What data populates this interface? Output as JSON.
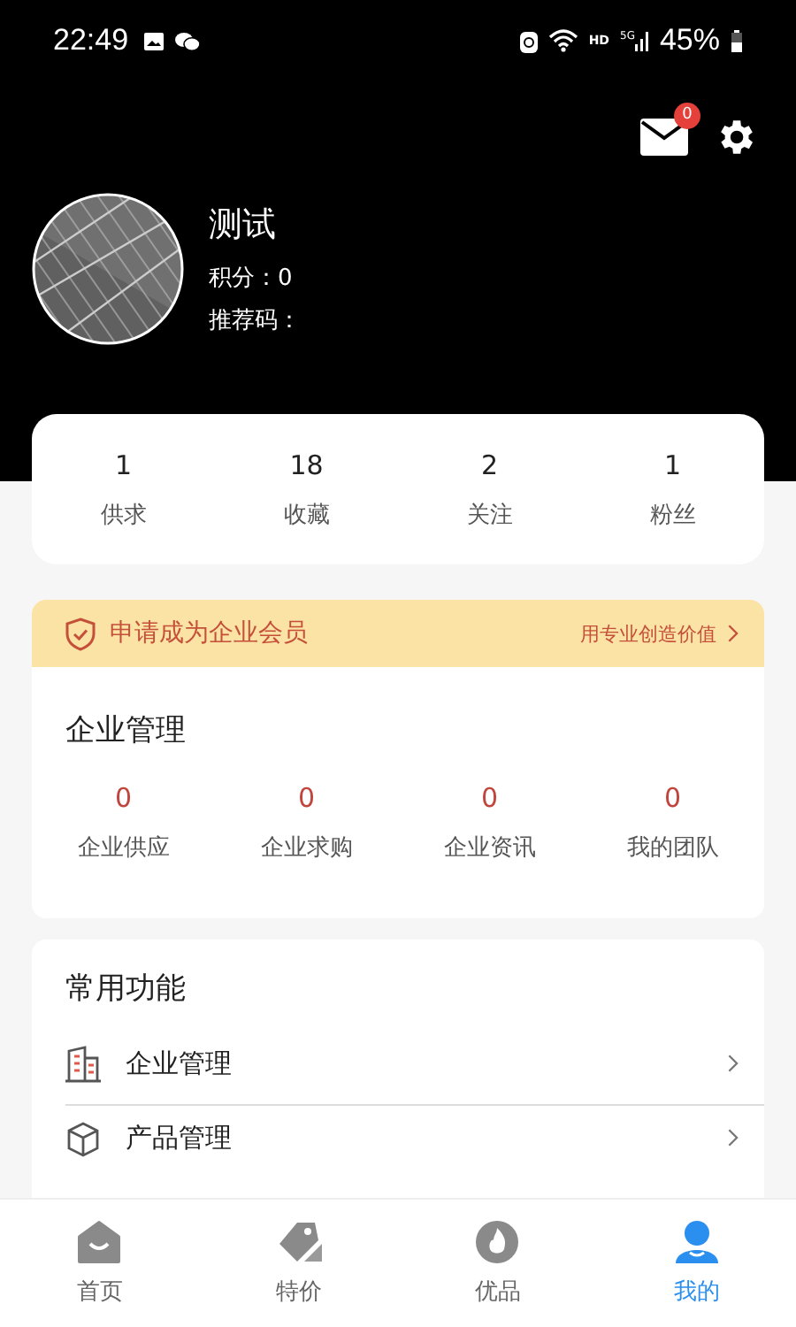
{
  "status_bar": {
    "time": "22:49",
    "network": "HD",
    "signal_type": "5G",
    "battery": "45%"
  },
  "header": {
    "mail_badge": "0",
    "name": "测试",
    "points": "积分：0",
    "referral": "推荐码："
  },
  "stats": [
    {
      "value": "1",
      "label": "供求"
    },
    {
      "value": "18",
      "label": "收藏"
    },
    {
      "value": "2",
      "label": "关注"
    },
    {
      "value": "1",
      "label": "粉丝"
    }
  ],
  "member_banner": {
    "title": "申请成为企业会员",
    "link": "用专业创造价值"
  },
  "enterprise": {
    "title": "企业管理",
    "items": [
      {
        "value": "0",
        "label": "企业供应"
      },
      {
        "value": "0",
        "label": "企业求购"
      },
      {
        "value": "0",
        "label": "企业资讯"
      },
      {
        "value": "0",
        "label": "我的团队"
      }
    ]
  },
  "common": {
    "title": "常用功能",
    "items": [
      {
        "kind": "building",
        "label": "企业管理"
      },
      {
        "kind": "box",
        "label": "产品管理"
      }
    ]
  },
  "tabs": [
    {
      "kind": "home",
      "label": "首页",
      "selected": false
    },
    {
      "kind": "tag",
      "label": "特价",
      "selected": false
    },
    {
      "kind": "fire",
      "label": "优品",
      "selected": false
    },
    {
      "kind": "user",
      "label": "我的",
      "selected": true
    }
  ]
}
